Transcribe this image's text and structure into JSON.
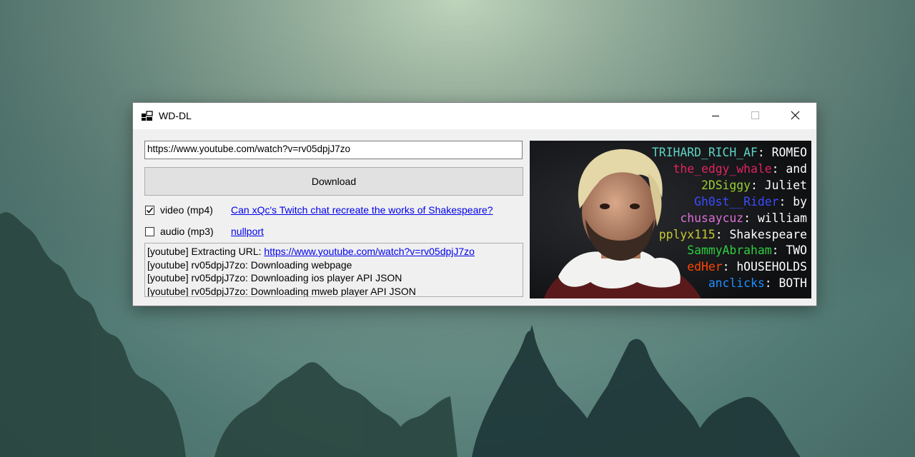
{
  "window": {
    "title": "WD-DL"
  },
  "url_input": {
    "value": "https://www.youtube.com/watch?v=rv05dpjJ7zo"
  },
  "download_button": {
    "label": "Download"
  },
  "options": {
    "video_label": "video (mp4)",
    "video_checked": true,
    "audio_label": "audio (mp3)",
    "audio_checked": false
  },
  "video_info": {
    "title_link": "Can xQc's Twitch chat recreate the works of Shakespeare?",
    "channel_link": "nullport"
  },
  "log": {
    "line1_prefix": "[youtube] Extracting URL: ",
    "line1_url": "https://www.youtube.com/watch?v=rv05dpjJ7zo",
    "line2": "[youtube] rv05dpjJ7zo: Downloading webpage",
    "line3": "[youtube] rv05dpjJ7zo: Downloading ios player API JSON",
    "line4": "[youtube] rv05dpjJ7zo: Downloading mweb player API JSON"
  },
  "thumbnail": {
    "chat": [
      {
        "user": "TRIHARD_RICH_AF",
        "msg": "ROMEO",
        "color": "#5fd3c4"
      },
      {
        "user": "the_edgy_whale",
        "msg": "and",
        "color": "#e0245e"
      },
      {
        "user": "2DSiggy",
        "msg": "Juliet",
        "color": "#9acd32"
      },
      {
        "user": "Gh0st__Rider",
        "msg": "by",
        "color": "#3b4cff"
      },
      {
        "user": "chusaycuz",
        "msg": "william",
        "color": "#da70d6"
      },
      {
        "user": "pplyx115",
        "msg": "Shakespeare",
        "color": "#c8c832"
      },
      {
        "user": "SammyAbraham",
        "msg": "TWO",
        "color": "#2ecc40"
      },
      {
        "user": "edHer",
        "msg": "hOUSEHOLDS",
        "color": "#ff4500"
      },
      {
        "user": "anclicks",
        "msg": "BOTH",
        "color": "#1e90ff"
      }
    ]
  }
}
